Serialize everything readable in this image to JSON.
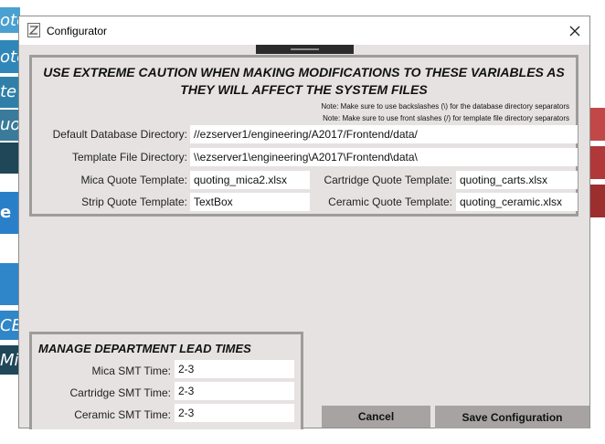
{
  "background": {
    "tiles": [
      "ote",
      "ote",
      "te",
      "uo",
      "",
      "e",
      "",
      "CE",
      "Mis"
    ]
  },
  "window": {
    "title": "Configurator",
    "close_symbol": "✕"
  },
  "variables": {
    "warning_line1": "USE EXTREME CAUTION WHEN MAKING MODIFICATIONS TO THESE VARIABLES AS",
    "warning_line2": "THEY WILL AFFECT THE SYSTEM FILES",
    "note1": "Note: Make sure to use backslashes (\\) for the database directory separators",
    "note2": "Note: Make sure to use front slashes (/) for template file directory separators",
    "db_dir_label": "Default Database Directory:",
    "db_dir_value": "//ezserver1/engineering/A2017/Frontend/data/",
    "template_dir_label": "Template File Directory:",
    "template_dir_value": "\\\\ezserver1\\engineering\\A2017\\Frontend\\data\\",
    "mica_label": "Mica Quote Template:",
    "mica_value": "quoting_mica2.xlsx",
    "cartridge_label": "Cartridge Quote Template:",
    "cartridge_value": "quoting_carts.xlsx",
    "strip_label": "Strip Quote Template:",
    "strip_value": "TextBox",
    "ceramic_label": "Ceramic Quote Template:",
    "ceramic_value": "quoting_ceramic.xlsx"
  },
  "lead_times": {
    "title": "MANAGE DEPARTMENT LEAD TIMES",
    "mica_label": "Mica SMT Time:",
    "mica_value": "2-3",
    "cartridge_label": "Cartridge SMT Time:",
    "cartridge_value": "2-3",
    "ceramic_label": "Ceramic SMT Time:",
    "ceramic_value": "2-3"
  },
  "buttons": {
    "cancel": "Cancel",
    "save": "Save Configuration"
  }
}
